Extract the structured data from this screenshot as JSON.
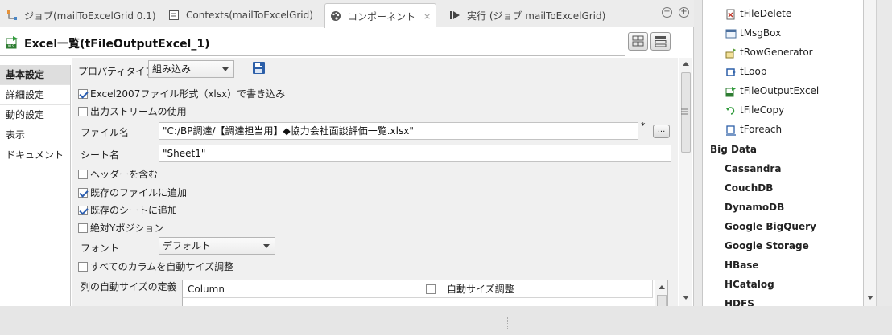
{
  "tabs": [
    {
      "label": "ジョブ(mailToExcelGrid 0.1)",
      "icon": "job-icon"
    },
    {
      "label": "Contexts(mailToExcelGrid)",
      "icon": "contexts-icon"
    },
    {
      "label": "コンポーネント",
      "icon": "palette-icon",
      "active": true,
      "close": "×"
    },
    {
      "label": "実行 (ジョブ mailToExcelGrid)",
      "icon": "run-icon"
    }
  ],
  "window_controls": {
    "minimize": "−",
    "maximize": "+"
  },
  "header": {
    "title": "Excel一覧(tFileOutputExcel_1)"
  },
  "vtabs": [
    "基本設定",
    "詳細設定",
    "動的設定",
    "表示",
    "ドキュメント"
  ],
  "form": {
    "property_type_label": "プロパティタイプ",
    "property_type_value": "組み込み",
    "excel2007": {
      "label": "Excel2007ファイル形式（xlsx）で書き込み",
      "checked": true
    },
    "output_stream": {
      "label": "出力ストリームの使用",
      "checked": false
    },
    "filename_label": "ファイル名",
    "filename_value": "\"C:/BP調達/【調達担当用】◆協力会社面談評価一覧.xlsx\"",
    "filename_required": "*",
    "browse_label": "...",
    "sheet_label": "シート名",
    "sheet_value": "\"Sheet1\"",
    "include_header": {
      "label": "ヘッダーを含む",
      "checked": false
    },
    "append_file": {
      "label": "既存のファイルに追加",
      "checked": true
    },
    "append_sheet": {
      "label": "既存のシートに追加",
      "checked": true
    },
    "abs_y": {
      "label": "絶対Yポジション",
      "checked": false
    },
    "font_label": "フォント",
    "font_value": "デフォルト",
    "autosize_all": {
      "label": "すべてのカラムを自動サイズ調整",
      "checked": false
    },
    "autosize_def_label": "列の自動サイズの定義",
    "table": {
      "col1": "Column",
      "col2": "自動サイズ調整"
    }
  },
  "palette": {
    "items": [
      "tFileDelete",
      "tMsgBox",
      "tRowGenerator",
      "tLoop",
      "tFileOutputExcel",
      "tFileCopy",
      "tForeach"
    ],
    "category": "Big Data",
    "subcategories": [
      "Cassandra",
      "CouchDB",
      "DynamoDB",
      "Google BigQuery",
      "Google Storage",
      "HBase",
      "HCatalog",
      "HDFS"
    ]
  },
  "colors": {
    "accent_green": "#2e9a3a",
    "tab_bg": "#ececec",
    "active_vtab": "#dedede"
  }
}
